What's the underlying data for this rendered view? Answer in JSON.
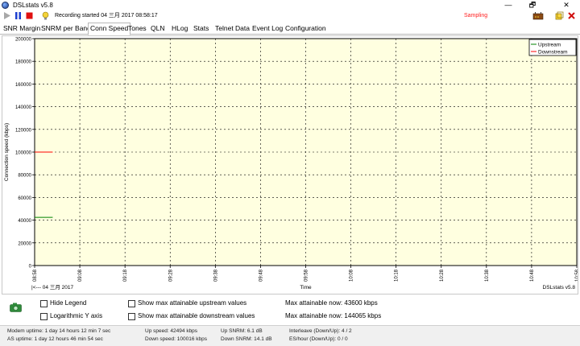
{
  "window": {
    "title": "DSLstats v5.8",
    "minimize": "—",
    "maximize": "🗗",
    "close": "✕"
  },
  "toolbar": {
    "play_icon": "play-icon",
    "pause_icon": "pause-icon",
    "stop_icon": "stop-icon",
    "bulb_icon": "bulb-icon",
    "recording": "Recording started 04 三月 2017 08:58:17",
    "sampling": "Sampling",
    "colors": {
      "play": "#a0a0a0",
      "pause": "#1d3fcf",
      "stop": "#e01010",
      "sampling": "#ff2020"
    }
  },
  "tabs": [
    {
      "label": "SNR Margin"
    },
    {
      "label": "SNRM per Band"
    },
    {
      "label": "Conn Speed",
      "active": true
    },
    {
      "label": "Tones"
    },
    {
      "label": "QLN"
    },
    {
      "label": "HLog"
    },
    {
      "label": "Stats"
    },
    {
      "label": "Telnet Data"
    },
    {
      "label": "Event Log"
    },
    {
      "label": "Configuration"
    }
  ],
  "chart_data": {
    "type": "line",
    "ylabel": "Connection speed (kbps)",
    "xlabel": "Time",
    "ylim": [
      0,
      200000
    ],
    "yticks": [
      "0",
      "20000",
      "40000",
      "60000",
      "80000",
      "100000",
      "120000",
      "140000",
      "160000",
      "180000",
      "200000"
    ],
    "xticks": [
      "08:58",
      "09:08",
      "09:18",
      "09:28",
      "09:38",
      "09:48",
      "09:58",
      "10:08",
      "10:18",
      "10:28",
      "10:38",
      "10:48",
      "10:58"
    ],
    "grid": true,
    "background": "#ffffe0",
    "legend_position": "top-right",
    "date_label": "|<--- 04 三月 2017",
    "watermark": "DSLstats v5.8",
    "series": [
      {
        "name": "Upstream",
        "color": "#008000",
        "x": [
          "08:58",
          "09:02"
        ],
        "values": [
          42494,
          42494
        ]
      },
      {
        "name": "Downstream",
        "color": "#ff0000",
        "x": [
          "08:58",
          "09:02"
        ],
        "values": [
          100016,
          100016
        ]
      }
    ]
  },
  "controls": {
    "camera_icon": "camera-icon",
    "hide_legend": "Hide Legend",
    "log_y": "Logarithmic Y axis",
    "show_max_up": "Show max attainable upstream values",
    "show_max_down": "Show max attainable downstream values",
    "max_up_now": "Max attainable now: 43600 kbps",
    "max_down_now": "Max attainable now: 144065 kbps"
  },
  "status": {
    "modem_uptime": "Modem uptime: 1 day 14 hours 12 min 7 sec",
    "as_uptime": "AS uptime: 1 day 12 hours 46 min 54 sec",
    "up_speed": "Up speed: 42494 kbps",
    "down_speed": "Down speed: 100016 kbps",
    "up_snrm": "Up SNRM: 6.1 dB",
    "down_snrm": "Down SNRM: 14.1 dB",
    "interleave": "Interleave (Down/Up): 4 / 2",
    "es_hour": "ES/hour (Down/Up): 0 / 0"
  }
}
